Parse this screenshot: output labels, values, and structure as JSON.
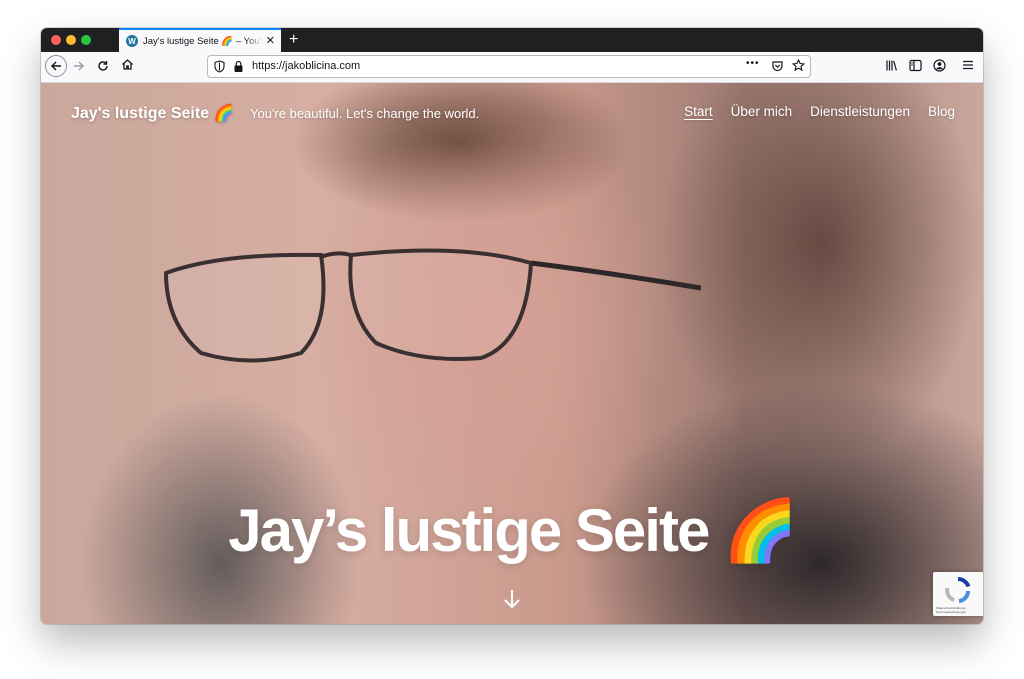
{
  "browser": {
    "tab_title": "Jay's lustige Seite 🌈 – You're beautiful. Let's change the world.",
    "favicon_letter": "W",
    "tab_close": "✕",
    "new_tab": "+",
    "url": "https://jakoblicina.com",
    "page_actions": "•••"
  },
  "site": {
    "title": "Jay's lustige Seite 🌈",
    "tagline": "You're beautiful. Let's change the world.",
    "menu": [
      {
        "label": "Start",
        "active": true
      },
      {
        "label": "Über mich",
        "active": false
      },
      {
        "label": "Dienstleistungen",
        "active": false
      },
      {
        "label": "Blog",
        "active": false
      }
    ],
    "hero_title": "Jay’s lustige Seite 🌈"
  },
  "recaptcha": {
    "label": "Datenschutzerklärung - Nutzungsbedingungen"
  },
  "colors": {
    "tab_accent": "#0a84ff",
    "tabbar_bg": "#202023",
    "toolbar_bg": "#f9f9fb",
    "recaptcha_blue": "#1c3aa9"
  }
}
